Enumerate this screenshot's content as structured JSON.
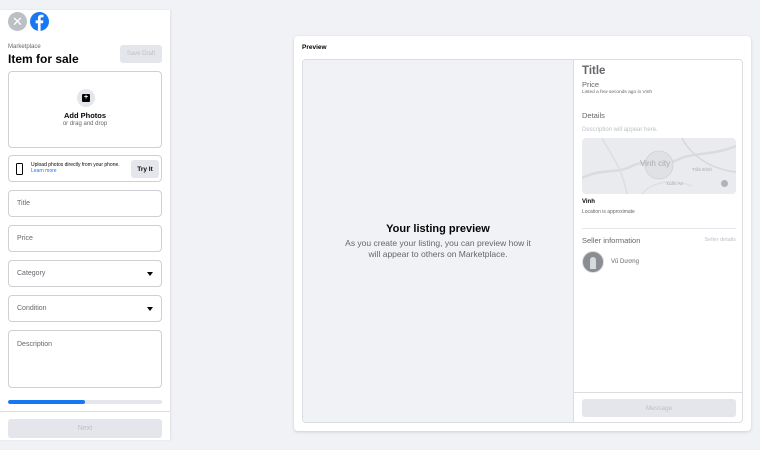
{
  "header": {
    "breadcrumb": "Marketplace",
    "title": "Item for sale",
    "save_draft_label": "Save Draft"
  },
  "icons": {
    "close": "close-icon",
    "logo": "facebook-logo-icon",
    "photo": "add-photo-icon",
    "phone": "phone-icon",
    "dropdown": "caret-down-icon"
  },
  "photos": {
    "title": "Add Photos",
    "subtitle": "or drag and drop"
  },
  "phone_upload": {
    "text": "Upload photos directly from your phone.",
    "link": "Learn more",
    "button": "Try It"
  },
  "form": {
    "title_placeholder": "Title",
    "price_placeholder": "Price",
    "category_placeholder": "Category",
    "condition_placeholder": "Condition",
    "description_placeholder": "Description"
  },
  "progress": {
    "percent": 50
  },
  "footer": {
    "next_label": "Next"
  },
  "preview": {
    "label": "Preview",
    "left": {
      "title": "Your listing preview",
      "subtitle": "As you create your listing, you can preview how it will appear to others on Marketplace."
    },
    "right": {
      "title": "Title",
      "price": "Price",
      "listed": "Listed a few seconds ago in Vinh",
      "details_heading": "Details",
      "description_placeholder": "Description will appear here.",
      "map_city": "Vinh city",
      "map_label_1": "Trần Đình",
      "map_label_2": "Xuân An",
      "location": "Vinh",
      "location_note": "Location is approximate",
      "seller_heading": "Seller information",
      "seller_details": "Seller details",
      "seller_name": "Vũ Dương",
      "message_label": "Message"
    }
  },
  "colors": {
    "accent": "#1877f2",
    "disabled_bg": "#e4e6eb",
    "disabled_text": "#bcc0c4",
    "page_bg": "#f0f2f5"
  }
}
